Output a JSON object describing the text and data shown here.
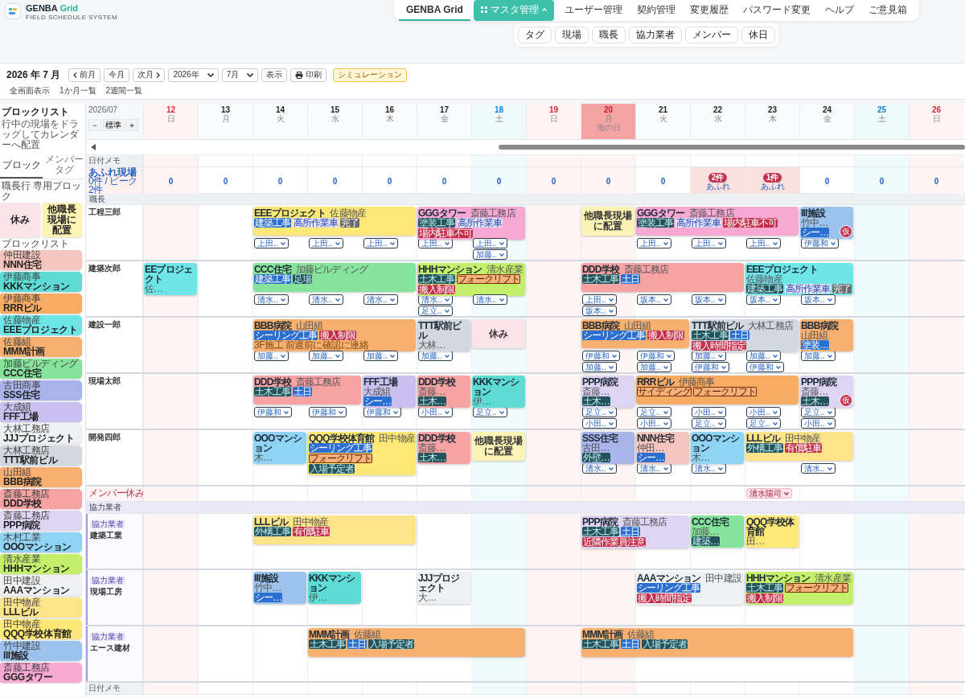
{
  "header": {
    "brand": [
      "GENBA",
      "Grid"
    ],
    "subtitle": "FIELD SCHEDULE SYSTEM",
    "nav": [
      {
        "label": "GENBA Grid",
        "kind": "link",
        "selected": true
      },
      {
        "label": "マスタ管理",
        "kind": "menu",
        "selected": false,
        "expanded": true
      },
      {
        "label": "ユーザー管理",
        "kind": "link",
        "selected": false
      },
      {
        "label": "契約管理",
        "kind": "link",
        "selected": false
      },
      {
        "label": "変更履歴",
        "kind": "link",
        "selected": false
      },
      {
        "label": "パスワード変更",
        "kind": "link",
        "selected": false
      },
      {
        "label": "ヘルプ",
        "kind": "link",
        "selected": false
      },
      {
        "label": "ご意見箱",
        "kind": "link",
        "selected": false
      }
    ],
    "subnav": [
      "タグ",
      "現場",
      "職長",
      "協力業者",
      "メンバー",
      "休日"
    ]
  },
  "toolbar": {
    "title": "2026 年 7 月",
    "controls": [
      {
        "kind": "prev",
        "label": "前月"
      },
      {
        "kind": "button",
        "label": "今月"
      },
      {
        "kind": "next",
        "label": "次月"
      },
      {
        "kind": "select",
        "label": "2026年"
      },
      {
        "kind": "select",
        "label": "7月"
      },
      {
        "kind": "button",
        "label": "表示"
      },
      {
        "kind": "print",
        "label": "印刷"
      },
      {
        "kind": "accent",
        "label": "シミュレーション"
      }
    ],
    "views": [
      "全画面表示",
      "1か月一覧",
      "2週間一覧"
    ]
  },
  "sidebar": {
    "title": "ブロックリスト",
    "hint": "行中の現場をドラッグしてカレンダーへ配置",
    "tabs": [
      {
        "label": "ブロック",
        "selected": true
      },
      {
        "label": "メンバータグ",
        "selected": false
      }
    ],
    "special_title": "職長行 専用ブロック",
    "special": [
      {
        "label": "休み",
        "color": "#fbe3ea"
      },
      {
        "label": "他職長現場に配置",
        "color": "#fdf3b5"
      }
    ],
    "list_title": "ブロックリスト",
    "blocks": [
      {
        "company": "仲田建設",
        "name": "NNN住宅",
        "color": "#f4c4bd"
      },
      {
        "company": "伊藤商事",
        "name": "KKKマンション",
        "color": "#5fdbd6"
      },
      {
        "company": "伊藤商事",
        "name": "RRRビル",
        "color": "#f8ab62"
      },
      {
        "company": "佐藤物産",
        "name": "EEEプロジェクト",
        "color": "#6ee6e8"
      },
      {
        "company": "佐藤組",
        "name": "MMM計画",
        "color": "#f8b070"
      },
      {
        "company": "加藤ビルディング",
        "name": "CCC住宅",
        "color": "#86e39b"
      },
      {
        "company": "古田商事",
        "name": "SSS住宅",
        "color": "#a9b4ea"
      },
      {
        "company": "大成組",
        "name": "FFF工場",
        "color": "#c9c0ef"
      },
      {
        "company": "大林工務店",
        "name": "JJJプロジェクト",
        "color": "#eef0f2"
      },
      {
        "company": "大林工務店",
        "name": "TTT駅前ビル",
        "color": "#d3d8e0"
      },
      {
        "company": "山田組",
        "name": "BBB病院",
        "color": "#f8b070"
      },
      {
        "company": "斎藤工務店",
        "name": "DDD学校",
        "color": "#f7a3a3"
      },
      {
        "company": "斎藤工務店",
        "name": "PPP病院",
        "color": "#ddd5f3"
      },
      {
        "company": "木村工業",
        "name": "OOOマンション",
        "color": "#8fd3f5"
      },
      {
        "company": "清水産業",
        "name": "HHHマンション",
        "color": "#c3ef6b"
      },
      {
        "company": "田中建設",
        "name": "AAAマンション",
        "color": "#eef0f2"
      },
      {
        "company": "田中物産",
        "name": "LLLビル",
        "color": "#fde38a"
      },
      {
        "company": "田中物産",
        "name": "QQQ学校体育館",
        "color": "#fde777"
      },
      {
        "company": "竹中建設",
        "name": "III施設",
        "color": "#9cc3ee"
      },
      {
        "company": "斎藤工務店",
        "name": "GGGタワー",
        "color": "#f7a8d3"
      }
    ]
  },
  "calendar": {
    "month": "2026/07",
    "zoom": [
      "－",
      "標準",
      "＋"
    ],
    "days": [
      {
        "date": "12",
        "weekday": "日",
        "kind": "sun"
      },
      {
        "date": "13",
        "weekday": "月",
        "kind": "weekday"
      },
      {
        "date": "14",
        "weekday": "火",
        "kind": "weekday"
      },
      {
        "date": "15",
        "weekday": "水",
        "kind": "weekday"
      },
      {
        "date": "16",
        "weekday": "木",
        "kind": "weekday"
      },
      {
        "date": "17",
        "weekday": "金",
        "kind": "weekday"
      },
      {
        "date": "18",
        "weekday": "土",
        "kind": "sat"
      },
      {
        "date": "19",
        "weekday": "日",
        "kind": "sun"
      },
      {
        "date": "20",
        "weekday": "月",
        "kind": "holiday",
        "holiday": "海の日"
      },
      {
        "date": "21",
        "weekday": "火",
        "kind": "weekday"
      },
      {
        "date": "22",
        "weekday": "水",
        "kind": "weekday"
      },
      {
        "date": "23",
        "weekday": "木",
        "kind": "weekday"
      },
      {
        "date": "24",
        "weekday": "金",
        "kind": "weekday"
      },
      {
        "date": "25",
        "weekday": "土",
        "kind": "sat"
      },
      {
        "date": "26",
        "weekday": "日",
        "kind": "sun"
      }
    ],
    "memo_label": "日付メモ",
    "overflow": {
      "label": "あふれ現場",
      "summary": "0件 / ピーク 2件",
      "cells": [
        {
          "count": "0",
          "over": false
        },
        {
          "count": "0",
          "over": false
        },
        {
          "count": "0",
          "over": false
        },
        {
          "count": "0",
          "over": false
        },
        {
          "count": "0",
          "over": false
        },
        {
          "count": "0",
          "over": false
        },
        {
          "count": "0",
          "over": false
        },
        {
          "count": "0",
          "over": false
        },
        {
          "count": "0",
          "over": false
        },
        {
          "count": "0",
          "over": false
        },
        {
          "count": "2件",
          "sub": "あふれ",
          "over": true
        },
        {
          "count": "1件",
          "sub": "あふれ",
          "over": true
        },
        {
          "count": "0",
          "over": false
        },
        {
          "count": "0",
          "over": false
        },
        {
          "count": "0",
          "over": false
        }
      ]
    },
    "foreman_section": "職長",
    "foremen": [
      {
        "name": "工程三郎",
        "days": [
          {
            "cont": false
          },
          {
            "cont": false
          },
          {
            "cont": false,
            "bar": {
              "kind": "site",
              "title": "EEEプロジェクト",
              "company": "佐藤物産",
              "color": "#fde777",
              "tags": [
                {
                  "text": "建築工事",
                  "kind": "blue"
                },
                {
                  "text": "高所作業車",
                  "kind": "light"
                },
                {
                  "text": "完了",
                  "kind": "gray"
                }
              ]
            },
            "chips": [
              "上田.."
            ]
          },
          {
            "cont": true,
            "chips": [
              "上田.."
            ]
          },
          {
            "cont": true,
            "chips": [
              "上田.."
            ]
          },
          {
            "cont": false,
            "bar": {
              "kind": "site",
              "title": "GGGタワー",
              "company": "斎藤工務店",
              "color": "#f7a8d3",
              "tags": [
                {
                  "text": "塗装工事",
                  "kind": "dark"
                },
                {
                  "text": "高所作業車",
                  "kind": "light"
                },
                {
                  "text": "場内駐車不可",
                  "kind": "red"
                }
              ]
            },
            "chips": [
              "上田.."
            ]
          },
          {
            "cont": true,
            "chips": [
              "上田..",
              "加藤.."
            ]
          },
          {
            "cont": false
          },
          {
            "cont": false,
            "bar": {
              "kind": "block",
              "title": "他職長現場に配置",
              "color": "#fdf3b5"
            }
          },
          {
            "cont": false,
            "bar": {
              "kind": "site",
              "title": "GGGタワー",
              "company": "斎藤工務店",
              "color": "#f7a8d3",
              "tags": [
                {
                  "text": "塗装工事",
                  "kind": "dark"
                },
                {
                  "text": "高所作業車",
                  "kind": "light"
                },
                {
                  "text": "場内駐車不可",
                  "kind": "red"
                }
              ]
            },
            "chips": [
              "上田.."
            ]
          },
          {
            "cont": true,
            "chips": [
              "上田.."
            ]
          },
          {
            "cont": true,
            "chips": [
              "上田.."
            ]
          },
          {
            "cont": false,
            "bar": {
              "kind": "site",
              "title": "III施設",
              "company": "竹中…",
              "color": "#9cc3ee",
              "tags": [
                {
                  "text": "シー…",
                  "kind": "blue"
                }
              ],
              "badge": "仮"
            },
            "chips": [
              "伊藤和"
            ]
          },
          {
            "cont": false
          },
          {
            "cont": false
          }
        ]
      },
      {
        "name": "建築次郎",
        "days": [
          {
            "cont": false,
            "bar": {
              "kind": "site",
              "title": "EEプロジェクト",
              "company": "佐…",
              "color": "#6ee6e8"
            }
          },
          {
            "cont": false
          },
          {
            "cont": false,
            "bar": {
              "kind": "site",
              "title": "CCC住宅",
              "company": "加藤ビルディング",
              "color": "#86e39b",
              "tags": [
                {
                  "text": "建築工事",
                  "kind": "blue"
                },
                {
                  "text": "足場",
                  "kind": "dark"
                }
              ]
            },
            "chips": [
              "清水.."
            ]
          },
          {
            "cont": true,
            "chips": [
              "清水.."
            ]
          },
          {
            "cont": true,
            "chips": [
              "清水.."
            ]
          },
          {
            "cont": false,
            "bar": {
              "kind": "site",
              "title": "HHHマンション",
              "company": "清水産業",
              "color": "#c3ef6b",
              "tags": [
                {
                  "text": "土木工事",
                  "kind": "dark"
                },
                {
                  "text": "フォークリフト",
                  "kind": "orange"
                },
                {
                  "text": "搬入制限",
                  "kind": "red"
                }
              ]
            },
            "chips": [
              "清水..",
              "足立.."
            ]
          },
          {
            "cont": true,
            "chips": [
              "清水.."
            ]
          },
          {
            "cont": false
          },
          {
            "cont": false,
            "bar": {
              "kind": "site",
              "title": "DDD学校",
              "company": "斎藤工務店",
              "color": "#f7a3a3",
              "tags": [
                {
                  "text": "土木工事",
                  "kind": "dark"
                },
                {
                  "text": "土日",
                  "kind": "blue"
                }
              ]
            },
            "chips": [
              "上田..",
              "坂本.."
            ]
          },
          {
            "cont": true,
            "chips": [
              "坂本.."
            ]
          },
          {
            "cont": true,
            "chips": [
              "坂本.."
            ]
          },
          {
            "cont": false,
            "bar": {
              "kind": "site",
              "title": "EEEプロジェクト",
              "company": "佐藤物産",
              "color": "#6ee6e8",
              "tags": [
                {
                  "text": "建築工事",
                  "kind": "dark"
                },
                {
                  "text": "高所作業車",
                  "kind": "light"
                },
                {
                  "text": "完了",
                  "kind": "gray"
                }
              ]
            },
            "chips": [
              "坂本.."
            ]
          },
          {
            "cont": true,
            "chips": [
              "坂本.."
            ]
          },
          {
            "cont": false
          },
          {
            "cont": false
          }
        ]
      },
      {
        "name": "建設一郎",
        "days": [
          {
            "cont": false
          },
          {
            "cont": false
          },
          {
            "cont": false,
            "bar": {
              "kind": "site",
              "title": "BBB病院",
              "company": "山田組",
              "color": "#f8b070",
              "tags": [
                {
                  "text": "シーリング工事",
                  "kind": "blue"
                },
                {
                  "text": "搬入制限",
                  "kind": "red"
                }
              ],
              "note": "3F施工 前週前に確認に連絡"
            },
            "chips": [
              "加藤.."
            ]
          },
          {
            "cont": true,
            "chips": [
              "加藤.."
            ]
          },
          {
            "cont": true,
            "chips": [
              "加藤.."
            ]
          },
          {
            "cont": false,
            "bar": {
              "kind": "site",
              "title": "TTT駅前ビル",
              "company": "大林…",
              "color": "#d3d8e0"
            },
            "chips": [
              "加藤.."
            ]
          },
          {
            "cont": false,
            "bar": {
              "kind": "block",
              "title": "休み",
              "color": "#fbe3ea"
            }
          },
          {
            "cont": false
          },
          {
            "cont": false,
            "bar": {
              "kind": "site",
              "title": "BBB病院",
              "company": "山田組",
              "color": "#f8b070",
              "tags": [
                {
                  "text": "シーリング工事",
                  "kind": "blue"
                },
                {
                  "text": "搬入制限",
                  "kind": "red"
                }
              ]
            },
            "chips": [
              "伊藤和",
              "加藤.."
            ]
          },
          {
            "cont": true,
            "chips": [
              "伊藤和",
              "加藤.."
            ]
          },
          {
            "cont": false,
            "bar": {
              "kind": "site",
              "title": "TTT駅前ビル",
              "company": "大林工務店",
              "color": "#d3d8e0",
              "tags": [
                {
                  "text": "土木工事",
                  "kind": "dark"
                },
                {
                  "text": "土日",
                  "kind": "blue"
                },
                {
                  "text": "搬入時間指定",
                  "kind": "red"
                }
              ]
            },
            "chips": [
              "加藤..",
              "伊藤和"
            ]
          },
          {
            "cont": true,
            "chips": [
              "加藤..",
              "伊藤和"
            ]
          },
          {
            "cont": false,
            "bar": {
              "kind": "site",
              "title": "BBB病院",
              "company": "山田組",
              "color": "#f8b070",
              "tags": [
                {
                  "text": "塗装…",
                  "kind": "blue"
                }
              ]
            },
            "chips": [
              "加藤.."
            ]
          },
          {
            "cont": false
          },
          {
            "cont": false
          }
        ]
      },
      {
        "name": "現場太郎",
        "days": [
          {
            "cont": false
          },
          {
            "cont": false
          },
          {
            "cont": false,
            "bar": {
              "kind": "site",
              "title": "DDD学校",
              "company": "斎藤工務店",
              "color": "#f7a3a3",
              "tags": [
                {
                  "text": "土木工事",
                  "kind": "dark"
                },
                {
                  "text": "土日",
                  "kind": "blue"
                }
              ]
            },
            "chips": [
              "伊藤和"
            ]
          },
          {
            "cont": true,
            "chips": [
              "伊藤和"
            ]
          },
          {
            "cont": false,
            "bar": {
              "kind": "site",
              "title": "FFF工場",
              "company": "大成組",
              "color": "#c9c0ef",
              "tags": [
                {
                  "text": "シー…",
                  "kind": "blue"
                }
              ]
            },
            "chips": [
              "伊藤和"
            ]
          },
          {
            "cont": false,
            "bar": {
              "kind": "site",
              "title": "DDD学校",
              "company": "斎藤…",
              "color": "#f7a3a3",
              "tags": [
                {
                  "text": "土木…",
                  "kind": "dark"
                }
              ]
            },
            "chips": [
              "小田.."
            ]
          },
          {
            "cont": false,
            "bar": {
              "kind": "site",
              "title": "KKKマンション",
              "company": "伊…",
              "color": "#5fdbd6"
            },
            "chips": [
              "足立.."
            ]
          },
          {
            "cont": false
          },
          {
            "cont": false,
            "bar": {
              "kind": "site",
              "title": "PPP病院",
              "company": "斎藤…",
              "color": "#ddd5f3",
              "tags": [
                {
                  "text": "土木…",
                  "kind": "dark"
                }
              ]
            },
            "chips": [
              "足立..",
              "小田.."
            ]
          },
          {
            "cont": false,
            "bar": {
              "kind": "site",
              "title": "RRRビル",
              "company": "伊藤商事",
              "color": "#f8ab62",
              "tags": [
                {
                  "text": "サイディング",
                  "kind": "orange"
                },
                {
                  "text": "フォークリフト",
                  "kind": "orange"
                }
              ]
            },
            "chips": [
              "足立..",
              "小田.."
            ]
          },
          {
            "cont": true,
            "chips": [
              "小田..",
              "足立.."
            ]
          },
          {
            "cont": true,
            "chips": [
              "小田..",
              "足立.."
            ]
          },
          {
            "cont": false,
            "bar": {
              "kind": "site",
              "title": "PPP病院",
              "company": "斎藤…",
              "color": "#ddd5f3",
              "tags": [
                {
                  "text": "土木…",
                  "kind": "dark"
                }
              ],
              "badge": "仮"
            },
            "chips": [
              "足立..",
              "小田.."
            ]
          },
          {
            "cont": false
          },
          {
            "cont": false
          }
        ]
      },
      {
        "name": "開発四郎",
        "days": [
          {
            "cont": false
          },
          {
            "cont": false
          },
          {
            "cont": false,
            "bar": {
              "kind": "site",
              "title": "OOOマンション",
              "company": "木…",
              "color": "#8fd3f5"
            }
          },
          {
            "cont": false,
            "bar": {
              "kind": "site",
              "title": "QQQ学校体育館",
              "company": "田中物産",
              "color": "#fde777",
              "tags": [
                {
                  "text": "シーリング工事",
                  "kind": "blue"
                },
                {
                  "text": "フォークリフト",
                  "kind": "orange"
                },
                {
                  "text": "入場予定者",
                  "kind": "dark"
                }
              ]
            }
          },
          {
            "cont": true
          },
          {
            "cont": false,
            "bar": {
              "kind": "site",
              "title": "DDD学校",
              "company": "斎藤…",
              "color": "#f7a3a3",
              "tags": [
                {
                  "text": "土木…",
                  "kind": "dark"
                }
              ]
            }
          },
          {
            "cont": false,
            "bar": {
              "kind": "block",
              "title": "他職長現場に配置",
              "color": "#fdf3b5"
            }
          },
          {
            "cont": false
          },
          {
            "cont": false,
            "bar": {
              "kind": "site",
              "title": "SSS住宅",
              "company": "古田…",
              "color": "#a9b4ea",
              "tags": [
                {
                  "text": "外壁…",
                  "kind": "dark"
                }
              ]
            },
            "chips": [
              "清水.."
            ]
          },
          {
            "cont": false,
            "bar": {
              "kind": "site",
              "title": "NNN住宅",
              "company": "仲田…",
              "color": "#f4c4bd",
              "tags": [
                {
                  "text": "シー…",
                  "kind": "blue"
                }
              ]
            },
            "chips": [
              "清水.."
            ]
          },
          {
            "cont": false,
            "bar": {
              "kind": "site",
              "title": "OOOマンション",
              "company": "木…",
              "color": "#8fd3f5"
            },
            "chips": [
              "清水.."
            ]
          },
          {
            "cont": false,
            "bar": {
              "kind": "site",
              "title": "LLLビル",
              "company": "田中物産",
              "color": "#fde38a",
              "tags": [
                {
                  "text": "外構工事",
                  "kind": "dark"
                },
                {
                  "text": "有償駐車",
                  "kind": "red"
                }
              ]
            }
          },
          {
            "cont": true,
            "chips": [
              "清水.."
            ]
          },
          {
            "cont": false
          },
          {
            "cont": false
          }
        ]
      }
    ],
    "member_off": {
      "label": "メンバー休み",
      "cells": [
        {
          "off": false
        },
        {
          "off": false
        },
        {
          "off": false
        },
        {
          "off": false
        },
        {
          "off": false
        },
        {
          "off": false
        },
        {
          "off": false
        },
        {
          "off": false
        },
        {
          "off": false
        },
        {
          "off": false
        },
        {
          "off": false
        },
        {
          "off": true,
          "name": "清水陽司"
        },
        {
          "off": false
        },
        {
          "off": false
        },
        {
          "off": false
        }
      ]
    },
    "partner_section": "協力業者",
    "partners": [
      {
        "badge": "協力業者",
        "name": "建築工業",
        "days": [
          {
            "cont": false
          },
          {
            "cont": false
          },
          {
            "cont": false,
            "bar": {
              "kind": "site",
              "title": "LLLビル",
              "company": "田中物産",
              "color": "#fde38a",
              "tags": [
                {
                  "text": "外構工事",
                  "kind": "dark"
                },
                {
                  "text": "有償駐車",
                  "kind": "red"
                }
              ]
            }
          },
          {
            "cont": true
          },
          {
            "cont": true
          },
          {
            "cont": false
          },
          {
            "cont": false
          },
          {
            "cont": false
          },
          {
            "cont": false,
            "bar": {
              "kind": "site",
              "title": "PPP病院",
              "company": "斎藤工務店",
              "color": "#ddd5f3",
              "tags": [
                {
                  "text": "土木工事",
                  "kind": "dark"
                },
                {
                  "text": "土日",
                  "kind": "blue"
                },
                {
                  "text": "近隣作業員注意",
                  "kind": "red"
                }
              ]
            }
          },
          {
            "cont": true
          },
          {
            "cont": false,
            "bar": {
              "kind": "site",
              "title": "CCC住宅",
              "company": "加藤…",
              "color": "#86e39b",
              "tags": [
                {
                  "text": "建築…",
                  "kind": "dark"
                }
              ]
            }
          },
          {
            "cont": false,
            "bar": {
              "kind": "site",
              "title": "QQQ学校体育館",
              "company": "田…",
              "color": "#fde777"
            }
          },
          {
            "cont": false
          },
          {
            "cont": false
          },
          {
            "cont": false
          }
        ]
      },
      {
        "badge": "協力業者",
        "name": "現場工房",
        "days": [
          {
            "cont": false
          },
          {
            "cont": false
          },
          {
            "cont": false,
            "bar": {
              "kind": "site",
              "title": "III施設",
              "company": "竹中…",
              "color": "#9cc3ee",
              "tags": [
                {
                  "text": "シー…",
                  "kind": "blue"
                }
              ]
            }
          },
          {
            "cont": false,
            "bar": {
              "kind": "site",
              "title": "KKKマンション",
              "company": "伊…",
              "color": "#5fdbd6"
            }
          },
          {
            "cont": false
          },
          {
            "cont": false,
            "bar": {
              "kind": "site",
              "title": "JJJプロジェクト",
              "company": "大…",
              "color": "#eef0f2"
            }
          },
          {
            "cont": false
          },
          {
            "cont": false
          },
          {
            "cont": false
          },
          {
            "cont": false,
            "bar": {
              "kind": "site",
              "title": "AAAマンション",
              "company": "田中建設",
              "color": "#eef0f2",
              "tags": [
                {
                  "text": "シーリング工事",
                  "kind": "blue"
                },
                {
                  "text": "搬入時間指定",
                  "kind": "red"
                }
              ]
            }
          },
          {
            "cont": true
          },
          {
            "cont": false,
            "bar": {
              "kind": "site",
              "title": "HHHマンション",
              "company": "清水産業",
              "color": "#c3ef6b",
              "tags": [
                {
                  "text": "土木工事",
                  "kind": "dark"
                },
                {
                  "text": "フォークリフト",
                  "kind": "orange"
                },
                {
                  "text": "搬入制限",
                  "kind": "red"
                }
              ]
            }
          },
          {
            "cont": true
          },
          {
            "cont": false
          },
          {
            "cont": false
          }
        ]
      },
      {
        "badge": "協力業者",
        "name": "エース建材",
        "days": [
          {
            "cont": false
          },
          {
            "cont": false
          },
          {
            "cont": false
          },
          {
            "cont": false,
            "bar": {
              "kind": "site",
              "title": "MMM計画",
              "company": "佐藤組",
              "color": "#f8b070",
              "tags": [
                {
                  "text": "土木工事",
                  "kind": "dark"
                },
                {
                  "text": "土日",
                  "kind": "blue"
                },
                {
                  "text": "入場予定者",
                  "kind": "dark"
                }
              ]
            }
          },
          {
            "cont": true
          },
          {
            "cont": true
          },
          {
            "cont": true
          },
          {
            "cont": false
          },
          {
            "cont": false,
            "bar": {
              "kind": "site",
              "title": "MMM計画",
              "company": "佐藤組",
              "color": "#f8b070",
              "tags": [
                {
                  "text": "土木工事",
                  "kind": "dark"
                },
                {
                  "text": "土日",
                  "kind": "blue"
                },
                {
                  "text": "入場予定者",
                  "kind": "dark"
                }
              ]
            }
          },
          {
            "cont": true
          },
          {
            "cont": true
          },
          {
            "cont": true
          },
          {
            "cont": true
          },
          {
            "cont": false
          },
          {
            "cont": false
          }
        ]
      }
    ],
    "bottom_memo": "日付メモ"
  }
}
